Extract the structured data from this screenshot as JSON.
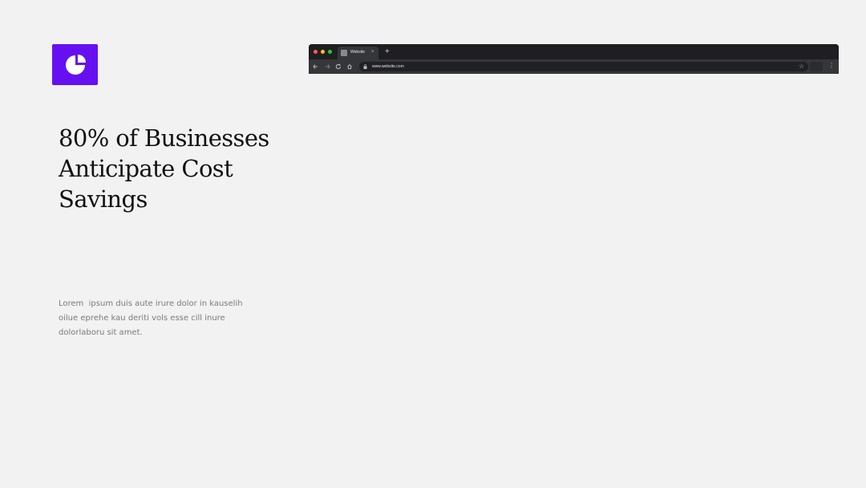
{
  "colors": {
    "accent": "#6610f2",
    "background": "#f2f2f2",
    "browser_frame": "#1f1f22",
    "browser_toolbar": "#35363a",
    "close_dot": "#ff5f57",
    "minimize_dot": "#febc2e",
    "maximize_dot": "#28c840"
  },
  "logo": {
    "icon": "pie-chart-icon"
  },
  "slide": {
    "headline": "80% of Businesses Anticipate Cost Savings",
    "body": "Lorem  ipsum duis aute irure dolor in kauselih oilue eprehe kau deriti vols esse cill inure dolorlaboru sit amet."
  },
  "browser": {
    "tab_title": "Website",
    "tab_close": "×",
    "new_tab": "+",
    "url": "www.website.com",
    "icons": {
      "back": "arrow-left-icon",
      "forward": "arrow-right-icon",
      "reload": "reload-icon",
      "home": "home-icon",
      "lock": "lock-icon",
      "bookmark": "star-icon",
      "menu": "kebab-menu-icon"
    }
  }
}
